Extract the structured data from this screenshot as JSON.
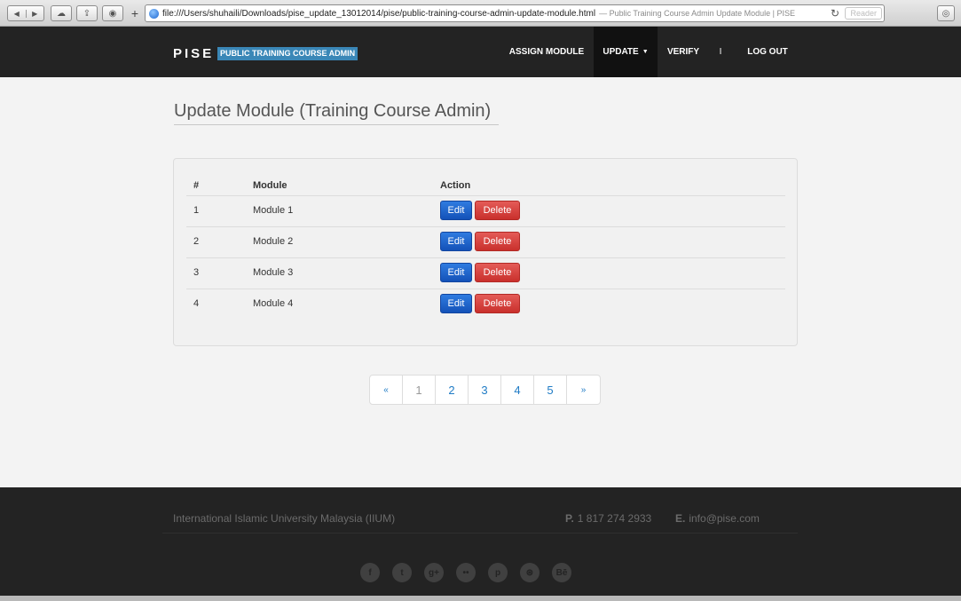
{
  "browser": {
    "url": "file:///Users/shuhaili/Downloads/pise_update_13012014/pise/public-training-course-admin-update-module.html",
    "page_title": "— Public Training Course Admin Update Module | PISE",
    "reader_label": "Reader"
  },
  "nav": {
    "brand": "PISE",
    "badge": "PUBLIC TRAINING COURSE ADMIN",
    "assign": "ASSIGN MODULE",
    "update": "UPDATE",
    "verify": "VERIFY",
    "separator": "I",
    "logout": "LOG OUT"
  },
  "main": {
    "title": "Update Module (Training Course Admin)",
    "table": {
      "headers": [
        "#",
        "Module",
        "Action"
      ],
      "rows": [
        {
          "num": "1",
          "module": "Module 1"
        },
        {
          "num": "2",
          "module": "Module 2"
        },
        {
          "num": "3",
          "module": "Module 3"
        },
        {
          "num": "4",
          "module": "Module 4"
        }
      ],
      "edit_label": "Edit",
      "delete_label": "Delete"
    },
    "pagination": {
      "prev": "«",
      "pages": [
        "1",
        "2",
        "3",
        "4",
        "5"
      ],
      "active": "1",
      "next": "»"
    }
  },
  "footer": {
    "org": "International Islamic University Malaysia (IIUM)",
    "phone_label": "P.",
    "phone": "1 817 274 2933",
    "email_label": "E.",
    "email": "info@pise.com",
    "socials": [
      "facebook-icon",
      "twitter-icon",
      "google-plus-icon",
      "flickr-icon",
      "pinterest-icon",
      "dribbble-icon",
      "behance-icon"
    ]
  },
  "colors": {
    "navbar": "#232323",
    "brand_badge": "#3a87b7",
    "edit_button": "#1f66cc",
    "delete_button": "#d9534f",
    "link": "#1f7bc5"
  }
}
